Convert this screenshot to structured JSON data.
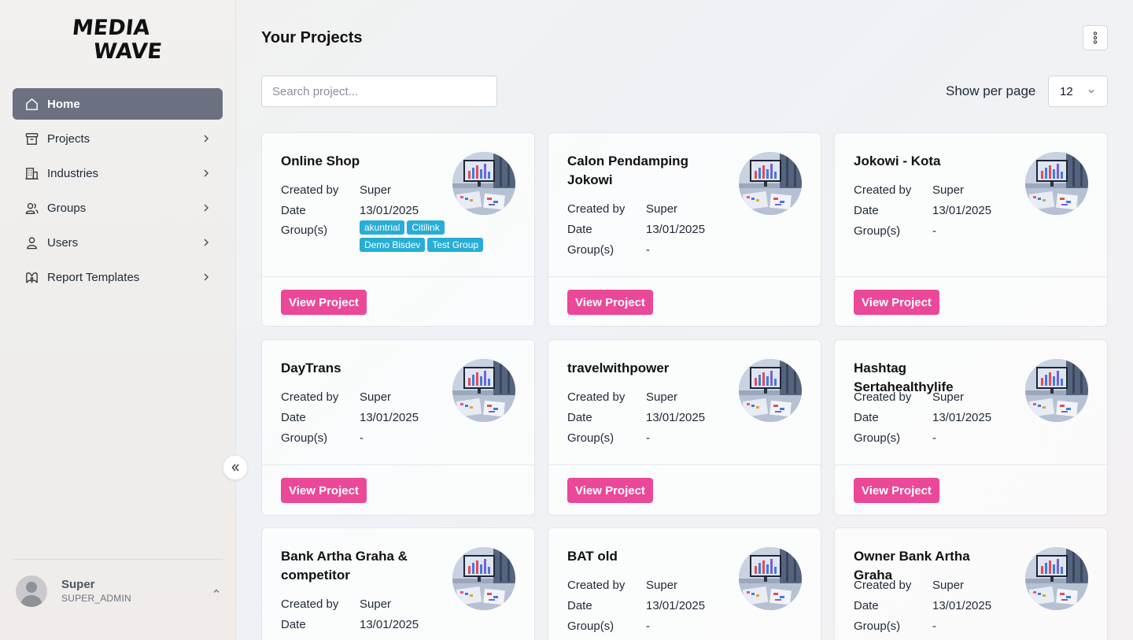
{
  "brand": {
    "logo_text": "MEDIA WAVE"
  },
  "sidebar": {
    "items": [
      {
        "label": "Home",
        "icon": "home-icon"
      },
      {
        "label": "Projects",
        "icon": "archive-icon"
      },
      {
        "label": "Industries",
        "icon": "building-icon"
      },
      {
        "label": "Groups",
        "icon": "users-icon"
      },
      {
        "label": "Users",
        "icon": "user-icon"
      },
      {
        "label": "Report Templates",
        "icon": "flower-icon"
      }
    ],
    "user": {
      "name": "Super",
      "role": "SUPER_ADMIN"
    }
  },
  "header": {
    "title": "Your Projects"
  },
  "search": {
    "placeholder": "Search project..."
  },
  "per_page": {
    "label": "Show per page",
    "value": "12"
  },
  "labels": {
    "created_by": "Created by",
    "date": "Date",
    "groups": "Group(s)",
    "view": "View Project"
  },
  "projects": [
    {
      "title": "Online Shop",
      "created_by": "Super",
      "date": "13/01/2025",
      "groups": [
        "akuntrial",
        "Citilink",
        "Demo Bisdev",
        "Test Group"
      ]
    },
    {
      "title": "Calon Pendamping Jokowi",
      "created_by": "Super",
      "date": "13/01/2025",
      "groups_text": "-"
    },
    {
      "title": "Jokowi - Kota",
      "created_by": "Super",
      "date": "13/01/2025",
      "groups_text": "-"
    },
    {
      "title": "DayTrans",
      "created_by": "Super",
      "date": "13/01/2025",
      "groups_text": "-"
    },
    {
      "title": "travelwithpower",
      "created_by": "Super",
      "date": "13/01/2025",
      "groups_text": "-"
    },
    {
      "title": "Hashtag Sertahealthylife",
      "created_by": "Super",
      "date": "13/01/2025",
      "groups_text": "-"
    },
    {
      "title": "Bank Artha Graha & competitor",
      "created_by": "Super",
      "date": "13/01/2025"
    },
    {
      "title": "BAT old",
      "created_by": "Super",
      "date": "13/01/2025",
      "groups_text": "-"
    },
    {
      "title": "Owner Bank Artha Graha",
      "created_by": "Super",
      "date": "13/01/2025",
      "groups_text": "-"
    }
  ]
}
